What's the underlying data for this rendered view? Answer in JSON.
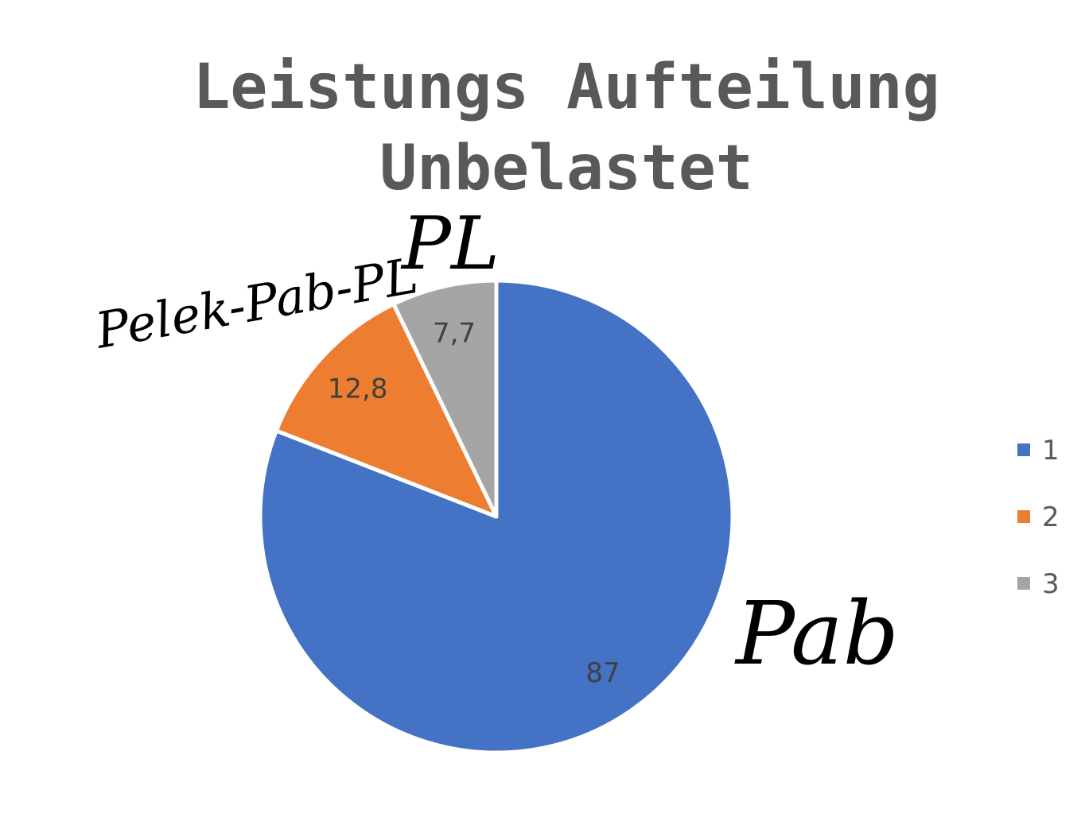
{
  "chart_data": {
    "type": "pie",
    "title": "Leistungs Aufteilung Unbelastet",
    "title_lines": [
      "Leistungs Aufteilung",
      "Unbelastet"
    ],
    "categories": [
      "1",
      "2",
      "3"
    ],
    "values": [
      87,
      12.8,
      7.7
    ],
    "data_labels": [
      "87",
      "12,8",
      "7,7"
    ],
    "colors": [
      "#4472C4",
      "#ED7D31",
      "#A5A5A5"
    ],
    "legend": {
      "entries": [
        "1",
        "2",
        "3"
      ],
      "position": "right"
    },
    "annotations": [
      "Pab",
      "Pelek-Pab-PL",
      "PL"
    ]
  }
}
